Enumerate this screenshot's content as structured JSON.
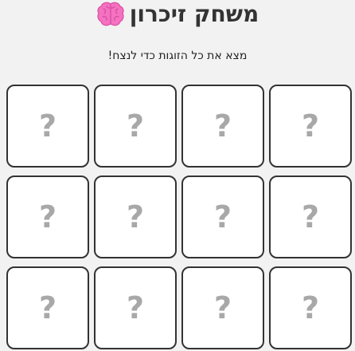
{
  "header": {
    "title": "משחק זיכרון",
    "icon": "brain-icon",
    "icon_color": "#f472c0"
  },
  "instruction": "מצא את כל הזוגות כדי לנצח!",
  "board": {
    "cards": [
      {
        "face": "?"
      },
      {
        "face": "?"
      },
      {
        "face": "?"
      },
      {
        "face": "?"
      },
      {
        "face": "?"
      },
      {
        "face": "?"
      },
      {
        "face": "?"
      },
      {
        "face": "?"
      },
      {
        "face": "?"
      },
      {
        "face": "?"
      },
      {
        "face": "?"
      },
      {
        "face": "?"
      }
    ],
    "card_border_color": "#333333",
    "card_back_color": "#ffffff",
    "face_color": "#a8a8a8"
  }
}
